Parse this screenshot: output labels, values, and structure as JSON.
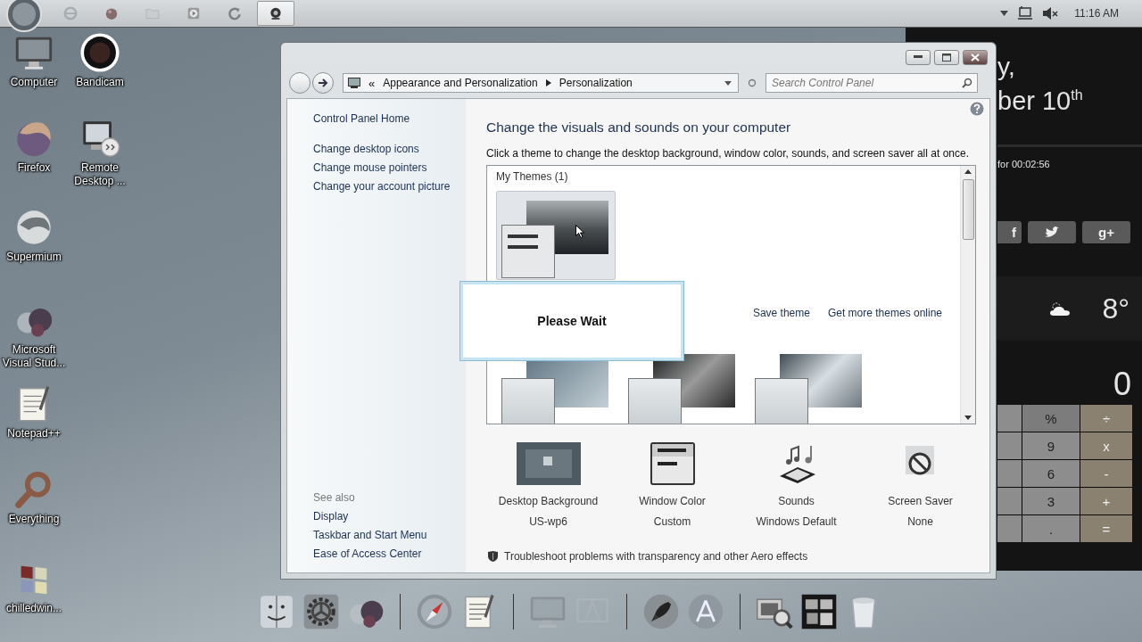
{
  "taskbar": {
    "apps": [
      {
        "selected": false
      },
      {
        "selected": false
      },
      {
        "selected": false
      },
      {
        "selected": false
      },
      {
        "selected": false
      },
      {
        "selected": true
      }
    ],
    "time": "11:16 AM"
  },
  "desktop_icons": [
    {
      "label": "Computer"
    },
    {
      "label": "Bandicam"
    },
    {
      "label": "Firefox"
    },
    {
      "label": "Remote Desktop ..."
    },
    {
      "label": "Supermium"
    },
    {
      "label": "Microsoft Visual Stud..."
    },
    {
      "label": "Notepad++"
    },
    {
      "label": "Everything"
    },
    {
      "label": "chilledwin..."
    }
  ],
  "widget_panel": {
    "greeting": "y,",
    "date": "ber 10$^{th}$",
    "timer": "for 00:02:56",
    "social": [
      "f",
      "g+"
    ],
    "temperature": "8°",
    "calculator_display": "0",
    "keys": [
      {
        "label": "%",
        "kind": "function"
      },
      {
        "label": "÷",
        "kind": "operator"
      },
      {
        "label": "9",
        "kind": "number"
      },
      {
        "label": "x",
        "kind": "operator"
      },
      {
        "label": "6",
        "kind": "number"
      },
      {
        "label": "-",
        "kind": "operator"
      },
      {
        "label": "3",
        "kind": "number"
      },
      {
        "label": "+",
        "kind": "operator"
      },
      {
        "label": ".",
        "kind": "number"
      },
      {
        "label": "=",
        "kind": "operator"
      }
    ]
  },
  "window": {
    "address": {
      "overflow": "«",
      "crumbs": [
        "Appearance and Personalization",
        "Personalization"
      ],
      "search_placeholder": "Search Control Panel"
    },
    "left_pane": {
      "home": "Control Panel Home",
      "tasks": [
        "Change desktop icons",
        "Change mouse pointers",
        "Change your account picture"
      ],
      "see_also_title": "See also",
      "see_also": [
        "Display",
        "Taskbar and Start Menu",
        "Ease of Access Center"
      ]
    },
    "title": "Change the visuals and sounds on your computer",
    "subtitle": "Click a theme to change the desktop background, window color, sounds, and screen saver all at once.",
    "themes": {
      "group_title": "My Themes (1)",
      "my_themes": [
        {
          "selected": true
        }
      ],
      "actions": [
        "Save theme",
        "Get more themes online"
      ],
      "installed_themes": [
        {
          "selected": false
        },
        {
          "selected": false
        },
        {
          "selected": false
        }
      ]
    },
    "settings": [
      {
        "label": "Desktop Background",
        "value": "US-wp6"
      },
      {
        "label": "Window Color",
        "value": "Custom"
      },
      {
        "label": "Sounds",
        "value": "Windows Default"
      },
      {
        "label": "Screen Saver",
        "value": "None"
      }
    ],
    "troubleshoot": "Troubleshoot problems with transparency and other Aero effects",
    "dialog": {
      "message": "Please Wait"
    }
  },
  "dock": {
    "groups": [
      [
        {
          "dimmed": false
        },
        {
          "dimmed": false
        },
        {
          "dimmed": false
        }
      ],
      [
        {
          "dimmed": false
        },
        {
          "dimmed": false
        }
      ],
      [
        {
          "dimmed": true
        },
        {
          "dimmed": true
        }
      ],
      [
        {
          "dimmed": false
        },
        {
          "dimmed": false
        }
      ],
      [
        {
          "dimmed": false
        },
        {
          "dimmed": false
        },
        {
          "dimmed": false
        }
      ]
    ]
  }
}
